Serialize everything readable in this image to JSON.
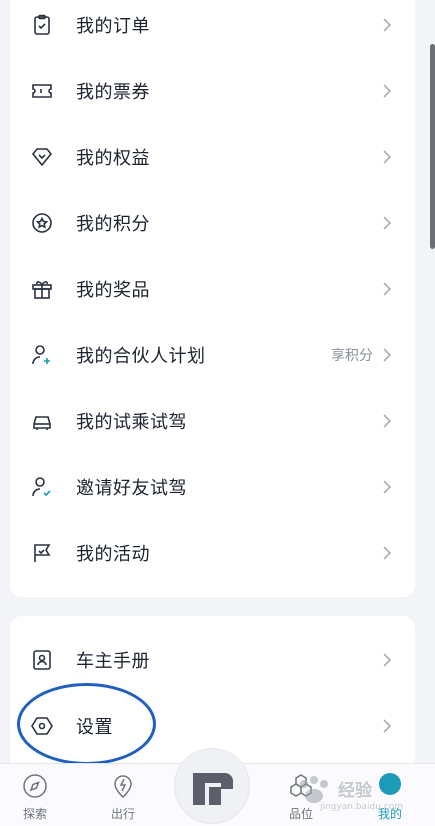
{
  "menu_primary": [
    {
      "icon": "order-clipboard-icon",
      "label": "我的订单"
    },
    {
      "icon": "ticket-icon",
      "label": "我的票券"
    },
    {
      "icon": "diamond-icon",
      "label": "我的权益"
    },
    {
      "icon": "points-star-icon",
      "label": "我的积分"
    },
    {
      "icon": "gift-icon",
      "label": "我的奖品"
    },
    {
      "icon": "add-user-icon",
      "label": "我的合伙人计划",
      "extra": "享积分"
    },
    {
      "icon": "car-icon",
      "label": "我的试乘试驾"
    },
    {
      "icon": "user-check-icon",
      "label": "邀请好友试驾"
    },
    {
      "icon": "flag-icon",
      "label": "我的活动"
    }
  ],
  "menu_secondary": [
    {
      "icon": "owner-manual-icon",
      "label": "车主手册"
    },
    {
      "icon": "settings-hexagon-icon",
      "label": "设置"
    }
  ],
  "tabbar": {
    "explore": "探索",
    "travel": "出行",
    "products": "品位",
    "me": "我的"
  },
  "watermark": {
    "text": "经验",
    "url": "jingyan.baidu.com"
  },
  "colors": {
    "accent": "#1e9ab9",
    "annotation": "#1f5fbf",
    "icon": "#2a3140"
  }
}
